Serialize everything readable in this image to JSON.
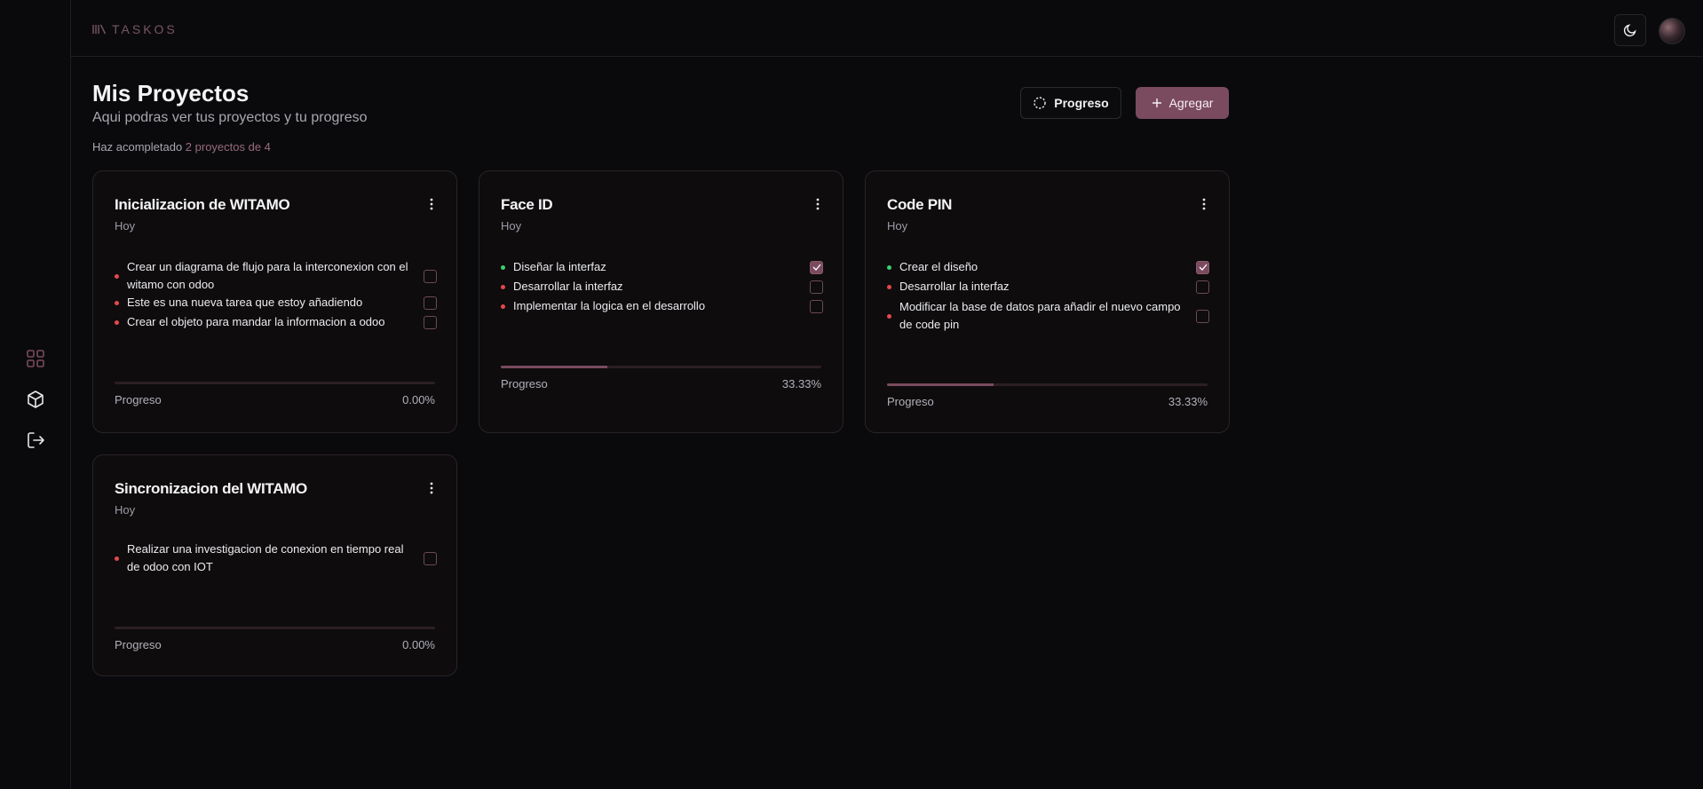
{
  "app": {
    "logo_text": "TASKOS"
  },
  "colors": {
    "accent": "#7a4b5f",
    "background": "#0a0a0c",
    "dot_pending": "#e5484d",
    "dot_done": "#3ccf6e"
  },
  "sidebar": {
    "items": [
      {
        "icon": "grid-icon",
        "active": true
      },
      {
        "icon": "cube-icon",
        "active": false
      },
      {
        "icon": "logout-icon",
        "active": false
      }
    ]
  },
  "topbar": {
    "theme_icon": "moon-icon",
    "avatar_icon": "avatar"
  },
  "header": {
    "title": "Mis Proyectos",
    "subtitle": "Aqui podras ver tus proyectos y tu progreso",
    "completed_prefix": "Haz acompletado",
    "completed_accent": "2 proyectos de 4",
    "progress_button": "Progreso",
    "add_button": "Agregar"
  },
  "projects": [
    {
      "title": "Inicializacion de WITAMO",
      "date": "Hoy",
      "tasks": [
        {
          "text": "Crear un diagrama de flujo para la interconexion con el witamo con odoo",
          "done": false
        },
        {
          "text": "Este es una nueva tarea que estoy añadiendo",
          "done": false
        },
        {
          "text": "Crear el objeto para mandar la informacion a odoo",
          "done": false
        }
      ],
      "progress_label": "Progreso",
      "progress": 0,
      "progress_text": "0.00%"
    },
    {
      "title": "Face ID",
      "date": "Hoy",
      "tasks": [
        {
          "text": "Diseñar la interfaz",
          "done": true
        },
        {
          "text": "Desarrollar la interfaz",
          "done": false
        },
        {
          "text": "Implementar la logica en el desarrollo",
          "done": false
        }
      ],
      "progress_label": "Progreso",
      "progress": 33.33,
      "progress_text": "33.33%"
    },
    {
      "title": "Code PIN",
      "date": "Hoy",
      "tasks": [
        {
          "text": "Crear el diseño",
          "done": true
        },
        {
          "text": "Desarrollar la interfaz",
          "done": false
        },
        {
          "text": "Modificar la base de datos para añadir el nuevo campo de code pin",
          "done": false
        }
      ],
      "progress_label": "Progreso",
      "progress": 33.33,
      "progress_text": "33.33%"
    },
    {
      "title": "Sincronizacion del WITAMO",
      "date": "Hoy",
      "tasks": [
        {
          "text": "Realizar una investigacion de conexion en tiempo real de odoo con IOT",
          "done": false
        }
      ],
      "progress_label": "Progreso",
      "progress": 0,
      "progress_text": "0.00%"
    }
  ]
}
